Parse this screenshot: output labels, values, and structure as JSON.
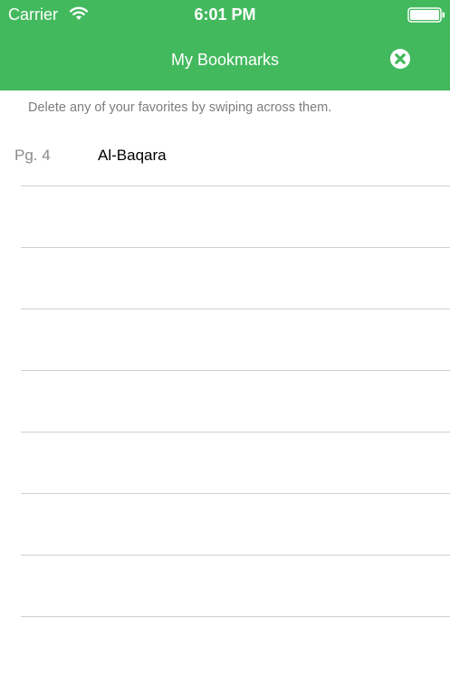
{
  "status_bar": {
    "carrier": "Carrier",
    "time": "6:01 PM"
  },
  "nav": {
    "title": "My Bookmarks",
    "close_icon": "close-circle-icon"
  },
  "hint": "Delete any of your favorites by swiping across them.",
  "bookmarks": [
    {
      "page": "Pg. 4",
      "title": "Al-Baqara"
    }
  ],
  "colors": {
    "accent": "#43b95e",
    "hint_text": "#7d7d7d",
    "separator": "#cfcfcf"
  }
}
